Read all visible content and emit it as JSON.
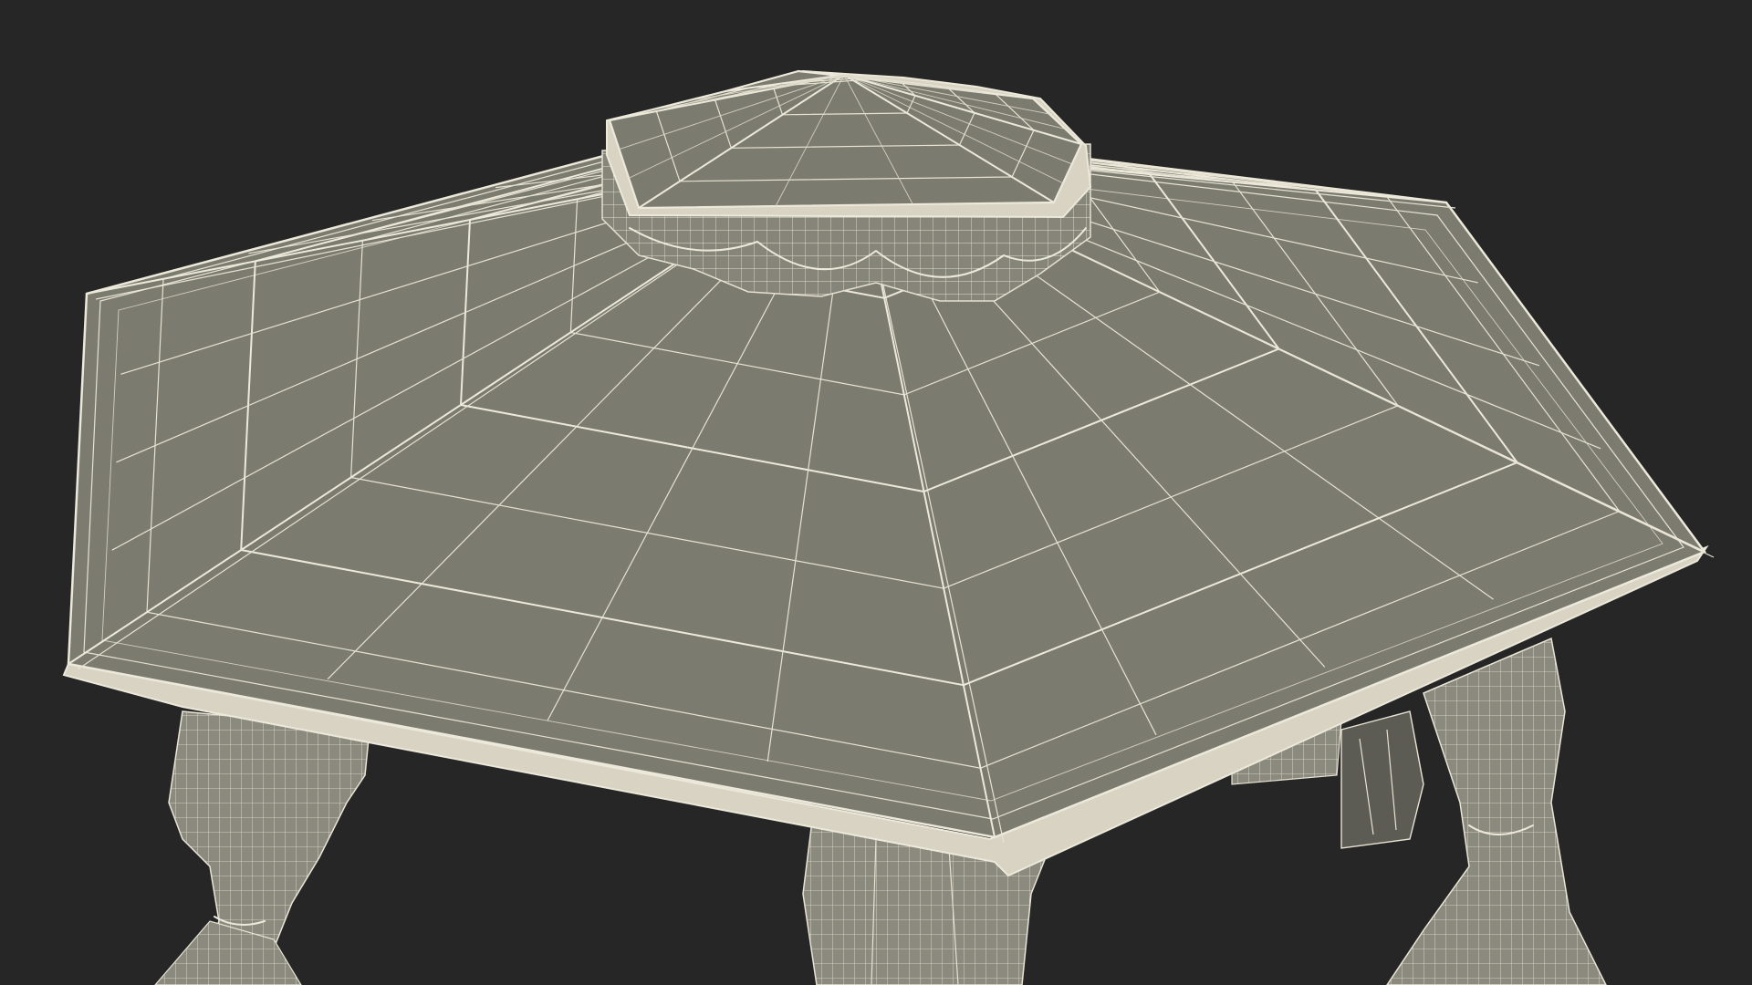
{
  "scene": {
    "background_color": "#262626",
    "surface_color": "#7b7b70",
    "surface_dark_color": "#6c6c62",
    "wire_color": "#ece8da",
    "fabric_color": "#8a897e",
    "subject_icon": "hexagonal-gazebo-wireframe-icon"
  }
}
